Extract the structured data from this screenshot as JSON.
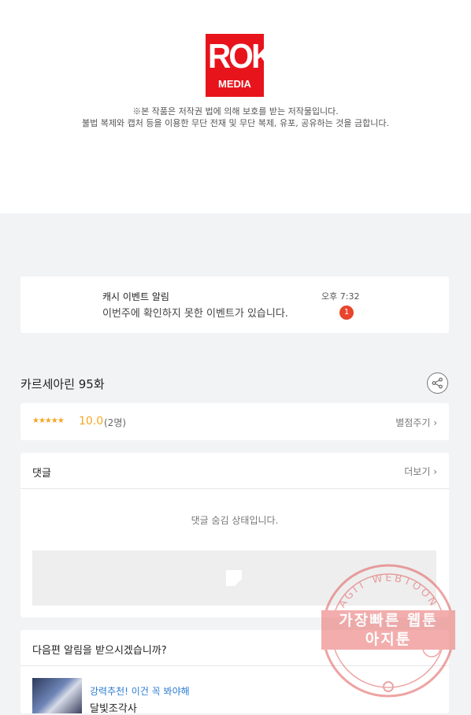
{
  "logo": {
    "line1": "ROK",
    "line2": "MEDIA"
  },
  "copyright": {
    "line1": "※본 작품은 저작권 법에 의해 보호를 받는 저작물입니다.",
    "line2": "불법 복제와 캡처 등을 이용한 무단 전재 및 무단 복제, 유포, 공유하는 것을 금합니다."
  },
  "notification": {
    "title": "캐시 이벤트 알림",
    "message": "이번주에 확인하지 못한 이벤트가 있습니다.",
    "time": "오후 7:32",
    "badge": "1"
  },
  "episode": {
    "title": "카르세아린 95화"
  },
  "rating": {
    "stars": "★★★★★",
    "score": "10.0",
    "votes": "(2명)",
    "action": "별점주기 ›"
  },
  "comments": {
    "title": "댓글",
    "more": "더보기 ›",
    "hidden_message": "댓글 숨김 상태입니다."
  },
  "next_alert": {
    "question": "다음편 알림을 받으시겠습니까?",
    "promo": "강력추천! 이건 꼭 봐야해",
    "work_title": "달빛조각사"
  },
  "watermark": {
    "ring_text": "AGIT WEBTOON",
    "line1": "가장빠른 웹툰",
    "line2": "아지툰"
  },
  "colors": {
    "brand": "#e8141c",
    "accent": "#f5a623",
    "link": "#2a7bd4",
    "badge": "#e8452c"
  }
}
